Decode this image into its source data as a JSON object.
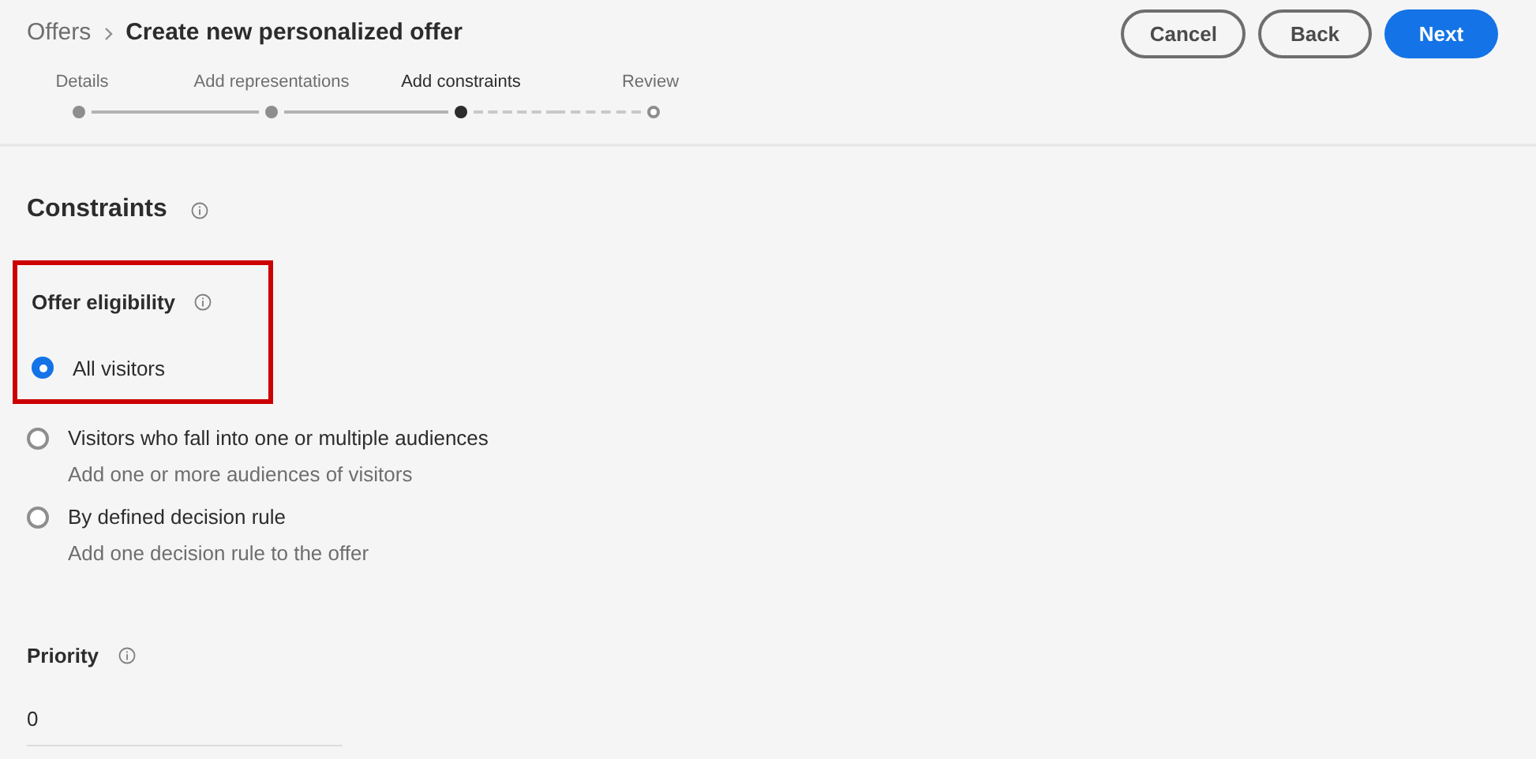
{
  "breadcrumb": {
    "parent": "Offers",
    "current": "Create new personalized offer"
  },
  "buttons": [
    {
      "label": "Cancel",
      "kind": "outline"
    },
    {
      "label": "Back",
      "kind": "outline"
    },
    {
      "label": "Next",
      "kind": "primary"
    }
  ],
  "steps": [
    {
      "label": "Details",
      "completed": true,
      "selected": false
    },
    {
      "label": "Add representations",
      "completed": true,
      "selected": false
    },
    {
      "label": "Add constraints",
      "completed": false,
      "selected": true
    },
    {
      "label": "Review",
      "completed": false,
      "selected": false
    }
  ],
  "section_title": "Constraints",
  "offer_eligibility": {
    "title": "Offer eligibility",
    "highlighted": true,
    "options": [
      {
        "label": "All visitors",
        "selected": true
      },
      {
        "label": "Visitors who fall into one or multiple audiences",
        "description": "Add one or more audiences of visitors",
        "selected": false
      },
      {
        "label": "By defined decision rule",
        "description": "Add one decision rule to the offer",
        "selected": false
      }
    ]
  },
  "priority": {
    "label": "Priority",
    "value": "0"
  }
}
